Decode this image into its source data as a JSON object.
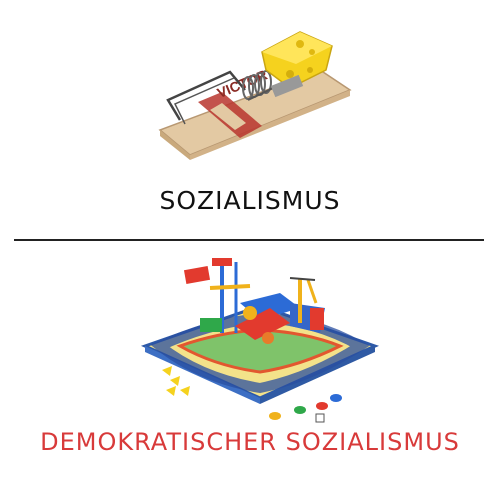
{
  "top": {
    "caption": "SOZIALISMUS",
    "image": "mousetrap-with-cheese",
    "brand_text": "VICTOR"
  },
  "bottom": {
    "caption": "DEMOKRATISCHER SOZIALISMUS",
    "image": "mouse-trap-board-game"
  },
  "colors": {
    "caption_top": "#111111",
    "caption_bottom": "#d83a3a",
    "divider": "#222222",
    "cheese": "#f5d21e",
    "wood": "#e3c9a3",
    "trap_red": "#b8352e"
  }
}
